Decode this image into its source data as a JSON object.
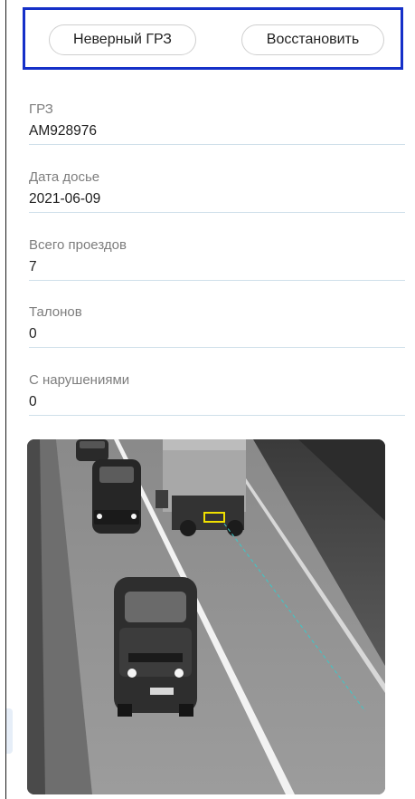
{
  "actions": {
    "wrong_plate_label": "Неверный ГРЗ",
    "restore_label": "Восстановить"
  },
  "fields": [
    {
      "label": "ГРЗ",
      "value": "AM928976"
    },
    {
      "label": "Дата досье",
      "value": "2021-06-09"
    },
    {
      "label": "Всего проездов",
      "value": "7"
    },
    {
      "label": "Талонов",
      "value": "0"
    },
    {
      "label": "С нарушениями",
      "value": "0"
    }
  ],
  "colors": {
    "highlight_border": "#1530c8",
    "plate_box": "#f0e000",
    "trajectory": "#3cc8c8",
    "divider": "#cfe0ea"
  }
}
